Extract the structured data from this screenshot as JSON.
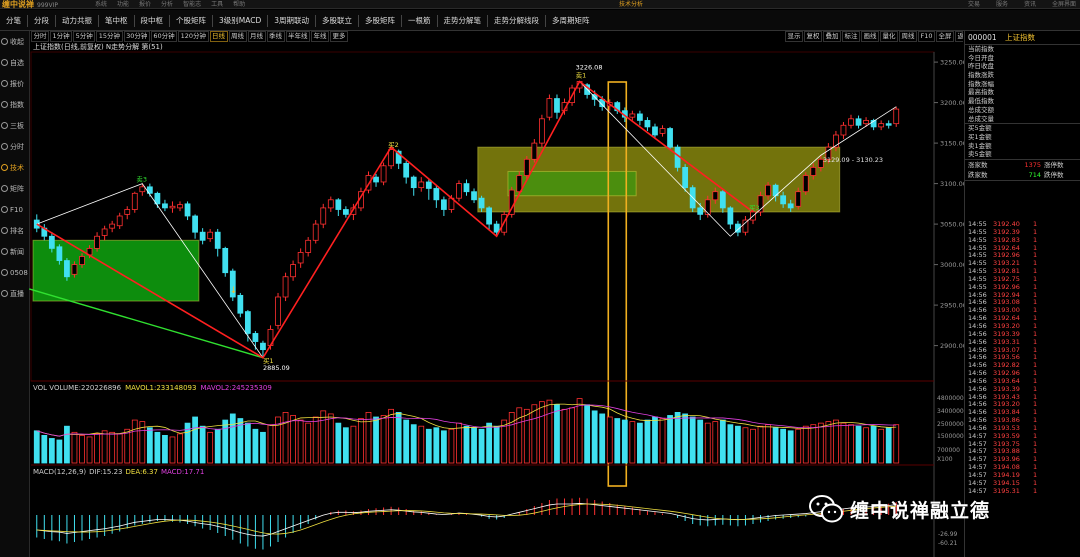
{
  "titlebar": {
    "logo": "缠中说禅",
    "vip": "999VIP",
    "menu": [
      "系统",
      "功能",
      "报价",
      "分析",
      "智能志",
      "工具",
      "帮助"
    ],
    "center_title": "技术分析",
    "right_menu": [
      "交易",
      "服务",
      "资讯",
      "全屏界面"
    ]
  },
  "toolbar": [
    "分笔",
    "分段",
    "动力共振",
    "笔中枢",
    "段中枢",
    "个股矩阵",
    "3级别MACD",
    "3周期联动",
    "多股联立",
    "多股矩阵",
    "一根筋",
    "走势分解笔",
    "走势分解线段",
    "多周期矩阵"
  ],
  "sidebar": [
    {
      "label": "收起",
      "active": false
    },
    {
      "label": "自选",
      "active": false
    },
    {
      "label": "报价",
      "active": false
    },
    {
      "label": "指数",
      "active": false
    },
    {
      "label": "三板",
      "active": false
    },
    {
      "label": "分时",
      "active": false
    },
    {
      "label": "技术",
      "active": true
    },
    {
      "label": "矩阵",
      "active": false
    },
    {
      "label": "F10",
      "active": false
    },
    {
      "label": "排名",
      "active": false
    },
    {
      "label": "新闻",
      "active": false
    },
    {
      "label": "0508",
      "active": false
    },
    {
      "label": "直播",
      "active": false
    }
  ],
  "periods": [
    {
      "label": "分时",
      "on": false
    },
    {
      "label": "1分钟",
      "on": false
    },
    {
      "label": "5分钟",
      "on": false
    },
    {
      "label": "15分钟",
      "on": false
    },
    {
      "label": "30分钟",
      "on": false
    },
    {
      "label": "60分钟",
      "on": false
    },
    {
      "label": "120分钟",
      "on": false
    },
    {
      "label": "日线",
      "on": true
    },
    {
      "label": "周线",
      "on": false
    },
    {
      "label": "月线",
      "on": false
    },
    {
      "label": "季线",
      "on": false
    },
    {
      "label": "半年线",
      "on": false
    },
    {
      "label": "年线",
      "on": false
    },
    {
      "label": "更多",
      "on": false
    }
  ],
  "chart_tools": [
    "显示",
    "复权",
    "叠加",
    "标注",
    "画线",
    "量化",
    "周线",
    "F10",
    "全屏",
    "返回"
  ],
  "chart_subtitle": "上证指数(日线,前复权) N走势分解 第(51)",
  "price_annotations": {
    "high": "3226.08",
    "low": "2885.09",
    "range": "3129.09 - 3130.23",
    "buy1": "买1",
    "buy2": "买2",
    "buy3": "买3",
    "sell1": "卖1",
    "sell3": "卖3"
  },
  "volume_indicator": {
    "name": "VOL VOLUME:",
    "value": "220226896",
    "mavol1": "MAVOL1:233148093",
    "mavol2": "MAVOL2:245235309"
  },
  "macd_indicator": {
    "name": "MACD(12,26,9)",
    "dif": "DIF:15.23",
    "dea": "DEA:6.37",
    "macd": "MACD:17.71"
  },
  "axis": {
    "price_ticks": [
      "3250.00",
      "3200.00",
      "3150.00",
      "3100.00",
      "3050.00",
      "3000.00",
      "2950.00",
      "2900.00"
    ],
    "vol_ticks": [
      "4800000",
      "3400000",
      "2500000",
      "1500000",
      "700000",
      "X100"
    ],
    "macd_ticks": [
      "-26.99",
      "-60.21"
    ]
  },
  "quote": {
    "code": "000001",
    "name": "上证指数",
    "labels": [
      "当前指数",
      "今日开盘",
      "昨日收盘",
      "指数涨跌",
      "指数涨幅",
      "最高指数",
      "最低指数",
      "总成交额",
      "总成交量"
    ],
    "buy_sell": [
      "买5金额",
      "买1金额",
      "卖1金额",
      "卖5金额"
    ],
    "up_label": "涨家数",
    "up_value": "1375",
    "up_label2": "涨停数",
    "down_label": "跌家数",
    "down_value": "714",
    "down_label2": "跌停数"
  },
  "ticks": [
    {
      "t": "14:55",
      "p": "3192.40",
      "v": "1"
    },
    {
      "t": "14:55",
      "p": "3192.39",
      "v": "1"
    },
    {
      "t": "14:55",
      "p": "3192.83",
      "v": "1"
    },
    {
      "t": "14:55",
      "p": "3192.64",
      "v": "1"
    },
    {
      "t": "14:55",
      "p": "3192.96",
      "v": "1"
    },
    {
      "t": "14:55",
      "p": "3193.21",
      "v": "1"
    },
    {
      "t": "14:55",
      "p": "3192.81",
      "v": "1"
    },
    {
      "t": "14:55",
      "p": "3192.75",
      "v": "1"
    },
    {
      "t": "14:55",
      "p": "3192.96",
      "v": "1"
    },
    {
      "t": "14:56",
      "p": "3192.94",
      "v": "1"
    },
    {
      "t": "14:56",
      "p": "3193.08",
      "v": "1"
    },
    {
      "t": "14:56",
      "p": "3193.00",
      "v": "1"
    },
    {
      "t": "14:56",
      "p": "3192.64",
      "v": "1"
    },
    {
      "t": "14:56",
      "p": "3193.20",
      "v": "1"
    },
    {
      "t": "14:56",
      "p": "3193.39",
      "v": "1"
    },
    {
      "t": "14:56",
      "p": "3193.31",
      "v": "1"
    },
    {
      "t": "14:56",
      "p": "3193.07",
      "v": "1"
    },
    {
      "t": "14:56",
      "p": "3193.56",
      "v": "1"
    },
    {
      "t": "14:56",
      "p": "3192.82",
      "v": "1"
    },
    {
      "t": "14:56",
      "p": "3192.96",
      "v": "1"
    },
    {
      "t": "14:56",
      "p": "3193.64",
      "v": "1"
    },
    {
      "t": "14:56",
      "p": "3193.39",
      "v": "1"
    },
    {
      "t": "14:56",
      "p": "3193.43",
      "v": "1"
    },
    {
      "t": "14:56",
      "p": "3193.20",
      "v": "1"
    },
    {
      "t": "14:56",
      "p": "3193.84",
      "v": "1"
    },
    {
      "t": "14:56",
      "p": "3193.86",
      "v": "1"
    },
    {
      "t": "14:56",
      "p": "3193.53",
      "v": "1"
    },
    {
      "t": "14:57",
      "p": "3193.59",
      "v": "1"
    },
    {
      "t": "14:57",
      "p": "3193.75",
      "v": "1"
    },
    {
      "t": "14:57",
      "p": "3193.88",
      "v": "1"
    },
    {
      "t": "14:57",
      "p": "3193.96",
      "v": "1"
    },
    {
      "t": "14:57",
      "p": "3194.08",
      "v": "1"
    },
    {
      "t": "14:57",
      "p": "3194.19",
      "v": "1"
    },
    {
      "t": "14:57",
      "p": "3194.15",
      "v": "1"
    },
    {
      "t": "14:57",
      "p": "3195.31",
      "v": "1"
    }
  ],
  "colors": {
    "up": "#ff3030",
    "down": "#40e0f0",
    "zone_green": "#10b010",
    "zone_yellow": "#9a9a10",
    "highlight": "#f0b020"
  },
  "watermark": "缠中说禅融立德",
  "chart_data": {
    "type": "candlestick",
    "ylim": [
      2860,
      3260
    ],
    "candles": [
      [
        3055,
        3045,
        3062,
        3040
      ],
      [
        3045,
        3035,
        3050,
        3030
      ],
      [
        3035,
        3020,
        3040,
        3015
      ],
      [
        3022,
        3005,
        3025,
        3000
      ],
      [
        3005,
        2985,
        3008,
        2980
      ],
      [
        2988,
        3000,
        3004,
        2984
      ],
      [
        3000,
        3010,
        3014,
        2996
      ],
      [
        3012,
        3020,
        3024,
        3008
      ],
      [
        3020,
        3035,
        3040,
        3016
      ],
      [
        3036,
        3044,
        3048,
        3030
      ],
      [
        3045,
        3050,
        3054,
        3040
      ],
      [
        3048,
        3060,
        3064,
        3044
      ],
      [
        3062,
        3068,
        3072,
        3056
      ],
      [
        3068,
        3088,
        3090,
        3064
      ],
      [
        3090,
        3096,
        3100,
        3085
      ],
      [
        3096,
        3088,
        3100,
        3084
      ],
      [
        3088,
        3075,
        3090,
        3070
      ],
      [
        3075,
        3070,
        3080,
        3066
      ],
      [
        3070,
        3072,
        3078,
        3064
      ],
      [
        3070,
        3074,
        3078,
        3066
      ],
      [
        3075,
        3060,
        3078,
        3055
      ],
      [
        3060,
        3040,
        3062,
        3032
      ],
      [
        3040,
        3030,
        3045,
        3025
      ],
      [
        3032,
        3040,
        3044,
        3028
      ],
      [
        3040,
        3020,
        3044,
        3010
      ],
      [
        3020,
        2990,
        3022,
        2985
      ],
      [
        2992,
        2960,
        2995,
        2955
      ],
      [
        2962,
        2940,
        2965,
        2935
      ],
      [
        2942,
        2915,
        2944,
        2905
      ],
      [
        2915,
        2905,
        2918,
        2895
      ],
      [
        2903,
        2895,
        2906,
        2885
      ],
      [
        2900,
        2920,
        2925,
        2895
      ],
      [
        2925,
        2960,
        2965,
        2920
      ],
      [
        2960,
        2985,
        2990,
        2955
      ],
      [
        2985,
        3000,
        3005,
        2980
      ],
      [
        3002,
        3015,
        3020,
        2996
      ],
      [
        3015,
        3030,
        3034,
        3010
      ],
      [
        3030,
        3050,
        3055,
        3026
      ],
      [
        3050,
        3070,
        3075,
        3045
      ],
      [
        3070,
        3080,
        3084,
        3065
      ],
      [
        3080,
        3068,
        3082,
        3060
      ],
      [
        3068,
        3062,
        3072,
        3058
      ],
      [
        3062,
        3070,
        3075,
        3055
      ],
      [
        3070,
        3090,
        3095,
        3066
      ],
      [
        3092,
        3110,
        3115,
        3088
      ],
      [
        3108,
        3102,
        3112,
        3096
      ],
      [
        3102,
        3122,
        3126,
        3098
      ],
      [
        3122,
        3142,
        3145,
        3118
      ],
      [
        3140,
        3125,
        3142,
        3118
      ],
      [
        3125,
        3108,
        3128,
        3100
      ],
      [
        3108,
        3095,
        3110,
        3085
      ],
      [
        3095,
        3102,
        3108,
        3090
      ],
      [
        3102,
        3094,
        3106,
        3080
      ],
      [
        3094,
        3080,
        3098,
        3070
      ],
      [
        3080,
        3068,
        3084,
        3060
      ],
      [
        3068,
        3082,
        3086,
        3064
      ],
      [
        3082,
        3100,
        3104,
        3078
      ],
      [
        3100,
        3090,
        3105,
        3085
      ],
      [
        3090,
        3080,
        3094,
        3076
      ],
      [
        3082,
        3070,
        3085,
        3065
      ],
      [
        3070,
        3050,
        3072,
        3042
      ],
      [
        3050,
        3040,
        3054,
        3035
      ],
      [
        3040,
        3062,
        3066,
        3036
      ],
      [
        3062,
        3092,
        3096,
        3058
      ],
      [
        3090,
        3110,
        3115,
        3086
      ],
      [
        3110,
        3130,
        3134,
        3105
      ],
      [
        3130,
        3150,
        3155,
        3126
      ],
      [
        3150,
        3180,
        3185,
        3145
      ],
      [
        3182,
        3205,
        3210,
        3178
      ],
      [
        3205,
        3188,
        3210,
        3180
      ],
      [
        3190,
        3200,
        3205,
        3185
      ],
      [
        3200,
        3218,
        3222,
        3196
      ],
      [
        3218,
        3226,
        3226,
        3212
      ],
      [
        3222,
        3210,
        3224,
        3205
      ],
      [
        3210,
        3204,
        3215,
        3196
      ],
      [
        3204,
        3195,
        3208,
        3190
      ],
      [
        3196,
        3200,
        3204,
        3190
      ],
      [
        3200,
        3190,
        3202,
        3186
      ],
      [
        3190,
        3182,
        3194,
        3176
      ],
      [
        3182,
        3186,
        3190,
        3178
      ],
      [
        3186,
        3178,
        3190,
        3172
      ],
      [
        3178,
        3170,
        3182,
        3165
      ],
      [
        3170,
        3160,
        3174,
        3155
      ],
      [
        3162,
        3168,
        3172,
        3158
      ],
      [
        3168,
        3145,
        3170,
        3142
      ],
      [
        3145,
        3120,
        3148,
        3115
      ],
      [
        3120,
        3095,
        3124,
        3090
      ],
      [
        3095,
        3070,
        3098,
        3065
      ],
      [
        3070,
        3062,
        3076,
        3055
      ],
      [
        3062,
        3080,
        3085,
        3058
      ],
      [
        3080,
        3090,
        3095,
        3075
      ],
      [
        3090,
        3070,
        3092,
        3064
      ],
      [
        3070,
        3050,
        3072,
        3044
      ],
      [
        3050,
        3040,
        3054,
        3035
      ],
      [
        3040,
        3055,
        3060,
        3036
      ],
      [
        3055,
        3065,
        3070,
        3050
      ],
      [
        3065,
        3085,
        3090,
        3060
      ],
      [
        3085,
        3098,
        3102,
        3080
      ],
      [
        3098,
        3085,
        3100,
        3078
      ],
      [
        3085,
        3075,
        3090,
        3070
      ],
      [
        3075,
        3070,
        3080,
        3065
      ],
      [
        3072,
        3090,
        3095,
        3068
      ],
      [
        3090,
        3110,
        3114,
        3086
      ],
      [
        3110,
        3120,
        3125,
        3105
      ],
      [
        3120,
        3130,
        3135,
        3115
      ],
      [
        3130,
        3145,
        3150,
        3125
      ],
      [
        3145,
        3160,
        3165,
        3140
      ],
      [
        3160,
        3172,
        3176,
        3155
      ],
      [
        3172,
        3180,
        3185,
        3168
      ],
      [
        3180,
        3172,
        3184,
        3168
      ],
      [
        3174,
        3178,
        3182,
        3170
      ],
      [
        3178,
        3170,
        3180,
        3166
      ],
      [
        3170,
        3174,
        3178,
        3166
      ],
      [
        3174,
        3172,
        3178,
        3168
      ],
      [
        3174,
        3192,
        3195,
        3170
      ]
    ],
    "volume": [
      210,
      180,
      160,
      150,
      240,
      200,
      180,
      170,
      190,
      210,
      200,
      190,
      220,
      280,
      270,
      230,
      200,
      180,
      170,
      190,
      260,
      300,
      240,
      200,
      220,
      280,
      320,
      290,
      260,
      220,
      200,
      250,
      300,
      330,
      310,
      280,
      260,
      300,
      340,
      320,
      260,
      230,
      240,
      290,
      330,
      300,
      310,
      350,
      330,
      280,
      250,
      240,
      220,
      230,
      210,
      220,
      260,
      240,
      230,
      220,
      260,
      240,
      280,
      330,
      360,
      350,
      380,
      400,
      410,
      380,
      350,
      360,
      420,
      380,
      340,
      320,
      300,
      290,
      280,
      270,
      260,
      280,
      300,
      290,
      310,
      330,
      320,
      300,
      280,
      260,
      270,
      280,
      250,
      240,
      230,
      220,
      240,
      250,
      230,
      220,
      210,
      220,
      240,
      250,
      260,
      270,
      280,
      260,
      250,
      240,
      230,
      240,
      220,
      230,
      250
    ],
    "macd": [
      -30,
      -32,
      -34,
      -35,
      -38,
      -36,
      -34,
      -32,
      -30,
      -28,
      -25,
      -22,
      -18,
      -14,
      -12,
      -10,
      -8,
      -8,
      -9,
      -10,
      -12,
      -15,
      -18,
      -20,
      -24,
      -28,
      -33,
      -38,
      -42,
      -45,
      -46,
      -42,
      -36,
      -30,
      -24,
      -18,
      -12,
      -6,
      0,
      4,
      6,
      6,
      5,
      6,
      8,
      9,
      10,
      11,
      10,
      8,
      6,
      5,
      3,
      1,
      0,
      1,
      3,
      2,
      0,
      -2,
      -5,
      -6,
      -4,
      0,
      4,
      8,
      12,
      16,
      20,
      22,
      22,
      22,
      23,
      22,
      20,
      18,
      16,
      14,
      12,
      10,
      8,
      6,
      4,
      2,
      0,
      -4,
      -8,
      -12,
      -14,
      -15,
      -14,
      -13,
      -14,
      -15,
      -14,
      -12,
      -10,
      -8,
      -6,
      -5,
      -4,
      -3,
      -2,
      0,
      2,
      4,
      6,
      8,
      10,
      11,
      12,
      13,
      14,
      15,
      17
    ],
    "bi_line": [
      {
        "i": 0,
        "y": 3050
      },
      {
        "i": 14,
        "y": 3100
      },
      {
        "i": 30,
        "y": 2885
      },
      {
        "i": 47,
        "y": 3145
      },
      {
        "i": 61,
        "y": 3035
      },
      {
        "i": 72,
        "y": 3226
      },
      {
        "i": 92,
        "y": 3035
      },
      {
        "i": 104,
        "y": 3135
      },
      {
        "i": 114,
        "y": 3195
      }
    ],
    "segment_line": [
      {
        "i": 0,
        "y": 3050
      },
      {
        "i": 30,
        "y": 2885
      },
      {
        "i": 47,
        "y": 3145
      },
      {
        "i": 61,
        "y": 3035
      },
      {
        "i": 72,
        "y": 3226
      },
      {
        "i": 95,
        "y": 3065
      }
    ],
    "green_segment": [
      {
        "i": -1,
        "y": 2970
      },
      {
        "i": 30,
        "y": 2885
      }
    ],
    "zones": [
      {
        "color": "green",
        "i0": 0,
        "i1": 22,
        "y0": 2955,
        "y1": 3030
      },
      {
        "color": "yellow",
        "i0": 59,
        "i1": 107,
        "y0": 3065,
        "y1": 3145
      },
      {
        "color": "green2",
        "i0": 63,
        "i1": 80,
        "y0": 3085,
        "y1": 3115
      }
    ],
    "highlight_bar": 77
  }
}
